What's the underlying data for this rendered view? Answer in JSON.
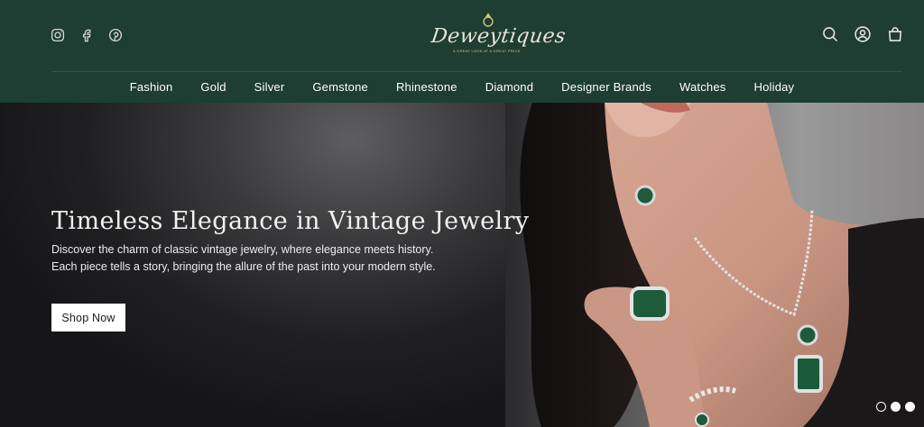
{
  "header": {
    "social": [
      {
        "name": "instagram-icon"
      },
      {
        "name": "facebook-icon"
      },
      {
        "name": "pinterest-icon"
      }
    ],
    "logo": {
      "text": "Deweytiques",
      "tagline": "A great look at a great price"
    },
    "utils": [
      {
        "name": "search-icon"
      },
      {
        "name": "account-icon"
      },
      {
        "name": "cart-icon"
      }
    ],
    "background_color": "#1e3d33"
  },
  "nav": {
    "items": [
      {
        "label": "Fashion"
      },
      {
        "label": "Gold"
      },
      {
        "label": "Silver"
      },
      {
        "label": "Gemstone"
      },
      {
        "label": "Rhinestone"
      },
      {
        "label": "Diamond"
      },
      {
        "label": "Designer Brands"
      },
      {
        "label": "Watches"
      },
      {
        "label": "Holiday"
      }
    ]
  },
  "hero": {
    "title": "Timeless Elegance in Vintage Jewelry",
    "description": "Discover the charm of classic vintage jewelry, where elegance meets history. Each piece tells a story, bringing the allure of the past into your modern style.",
    "button_label": "Shop Now",
    "slides": 3,
    "active_slide": 1
  }
}
